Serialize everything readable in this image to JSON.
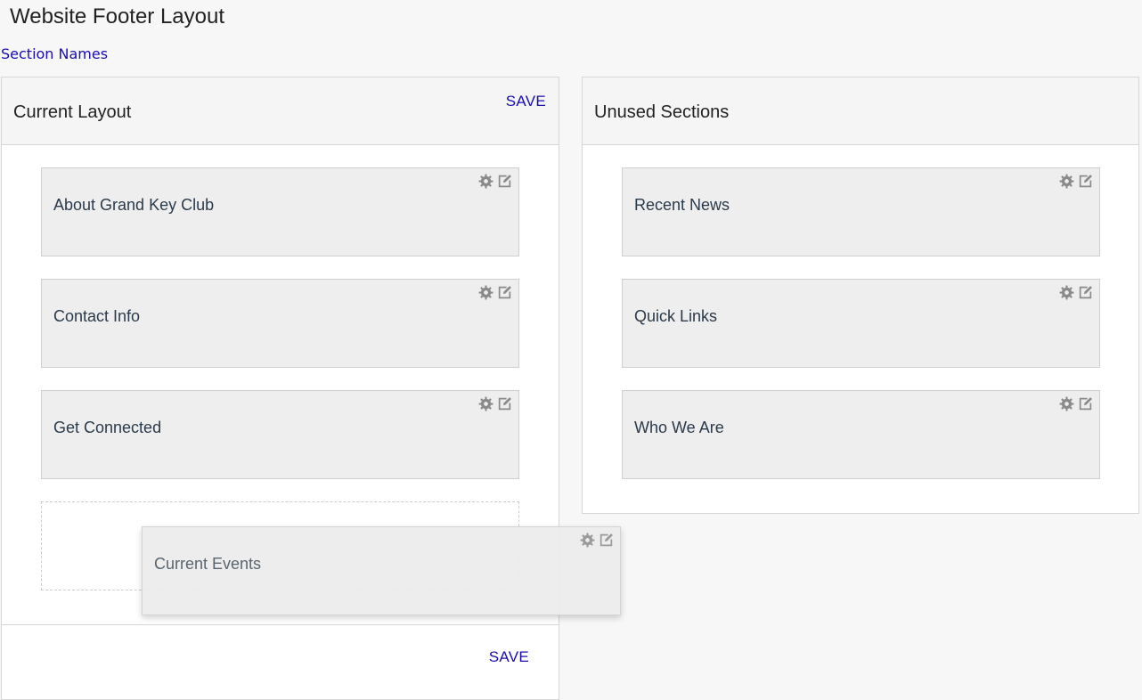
{
  "page": {
    "title": "Website Footer Layout",
    "section_names_link": "Section Names"
  },
  "current_layout": {
    "title": "Current Layout",
    "save_top_label": "SAVE",
    "save_bottom_label": "SAVE",
    "cards": [
      {
        "label": "About Grand Key Club"
      },
      {
        "label": "Contact Info"
      },
      {
        "label": "Get Connected"
      }
    ]
  },
  "unused_sections": {
    "title": "Unused Sections",
    "cards": [
      {
        "label": "Recent News"
      },
      {
        "label": "Quick Links"
      },
      {
        "label": "Who We Are"
      }
    ]
  },
  "dragging_card": {
    "label": "Current Events"
  },
  "icons": {
    "settings": "gear-icon",
    "edit": "edit-icon",
    "color": "#8a8a8a"
  },
  "colors": {
    "link": "#1a0dab",
    "card_bg": "#eeeeee",
    "header_bg": "#f5f5f5"
  }
}
